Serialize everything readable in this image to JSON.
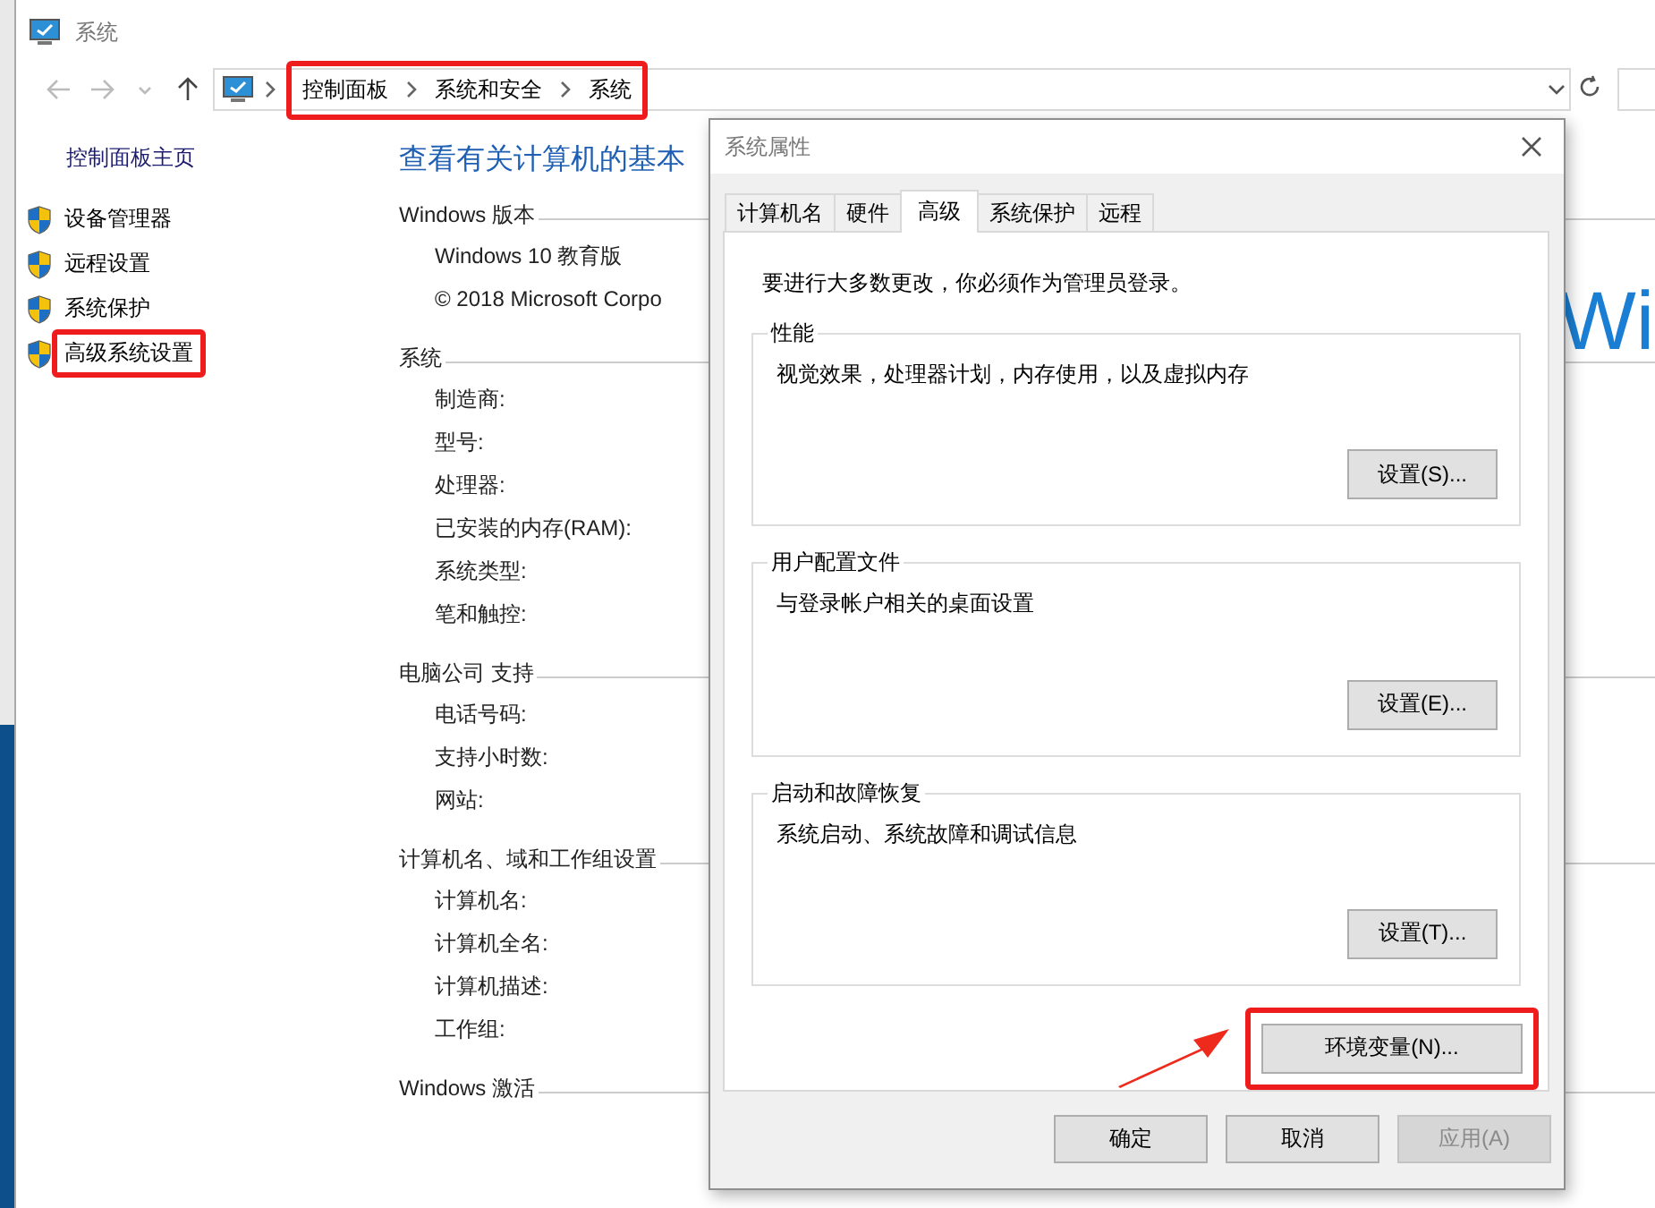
{
  "window": {
    "title": "系统"
  },
  "address_bar": {
    "crumbs": [
      "控制面板",
      "系统和安全",
      "系统"
    ],
    "highlighted": true
  },
  "sidebar": {
    "home": "控制面板主页",
    "items": [
      {
        "label": "设备管理器",
        "highlighted": false
      },
      {
        "label": "远程设置",
        "highlighted": false
      },
      {
        "label": "系统保护",
        "highlighted": false
      },
      {
        "label": "高级系统设置",
        "highlighted": true
      }
    ]
  },
  "main": {
    "heading": "查看有关计算机的基本",
    "logo_text": "Wi",
    "sections": [
      {
        "title": "Windows 版本",
        "rows": [
          "Windows 10 教育版",
          "© 2018 Microsoft Corpo"
        ]
      },
      {
        "title": "系统",
        "rows": [
          "制造商:",
          "型号:",
          "处理器:",
          "已安装的内存(RAM):",
          "系统类型:",
          "笔和触控:"
        ]
      },
      {
        "title": "电脑公司 支持",
        "rows": [
          "电话号码:",
          "支持小时数:",
          "网站:"
        ]
      },
      {
        "title": "计算机名、域和工作组设置",
        "rows": [
          "计算机名:",
          "计算机全名:",
          "计算机描述:",
          "工作组:"
        ]
      },
      {
        "title": "Windows 激活"
      }
    ]
  },
  "dialog": {
    "title": "系统属性",
    "tabs": [
      {
        "label": "计算机名",
        "selected": false
      },
      {
        "label": "硬件",
        "selected": false
      },
      {
        "label": "高级",
        "selected": true
      },
      {
        "label": "系统保护",
        "selected": false
      },
      {
        "label": "远程",
        "selected": false
      }
    ],
    "notice": "要进行大多数更改，你必须作为管理员登录。",
    "groups": [
      {
        "title": "性能",
        "description": "视觉效果，处理器计划，内存使用，以及虚拟内存",
        "button": "设置(S)..."
      },
      {
        "title": "用户配置文件",
        "description": "与登录帐户相关的桌面设置",
        "button": "设置(E)..."
      },
      {
        "title": "启动和故障恢复",
        "description": "系统启动、系统故障和调试信息",
        "button": "设置(T)..."
      }
    ],
    "env_button": {
      "label": "环境变量(N)...",
      "highlighted": true
    },
    "buttons": [
      {
        "label": "确定",
        "disabled": false
      },
      {
        "label": "取消",
        "disabled": false
      },
      {
        "label": "应用(A)",
        "disabled": true
      }
    ]
  }
}
